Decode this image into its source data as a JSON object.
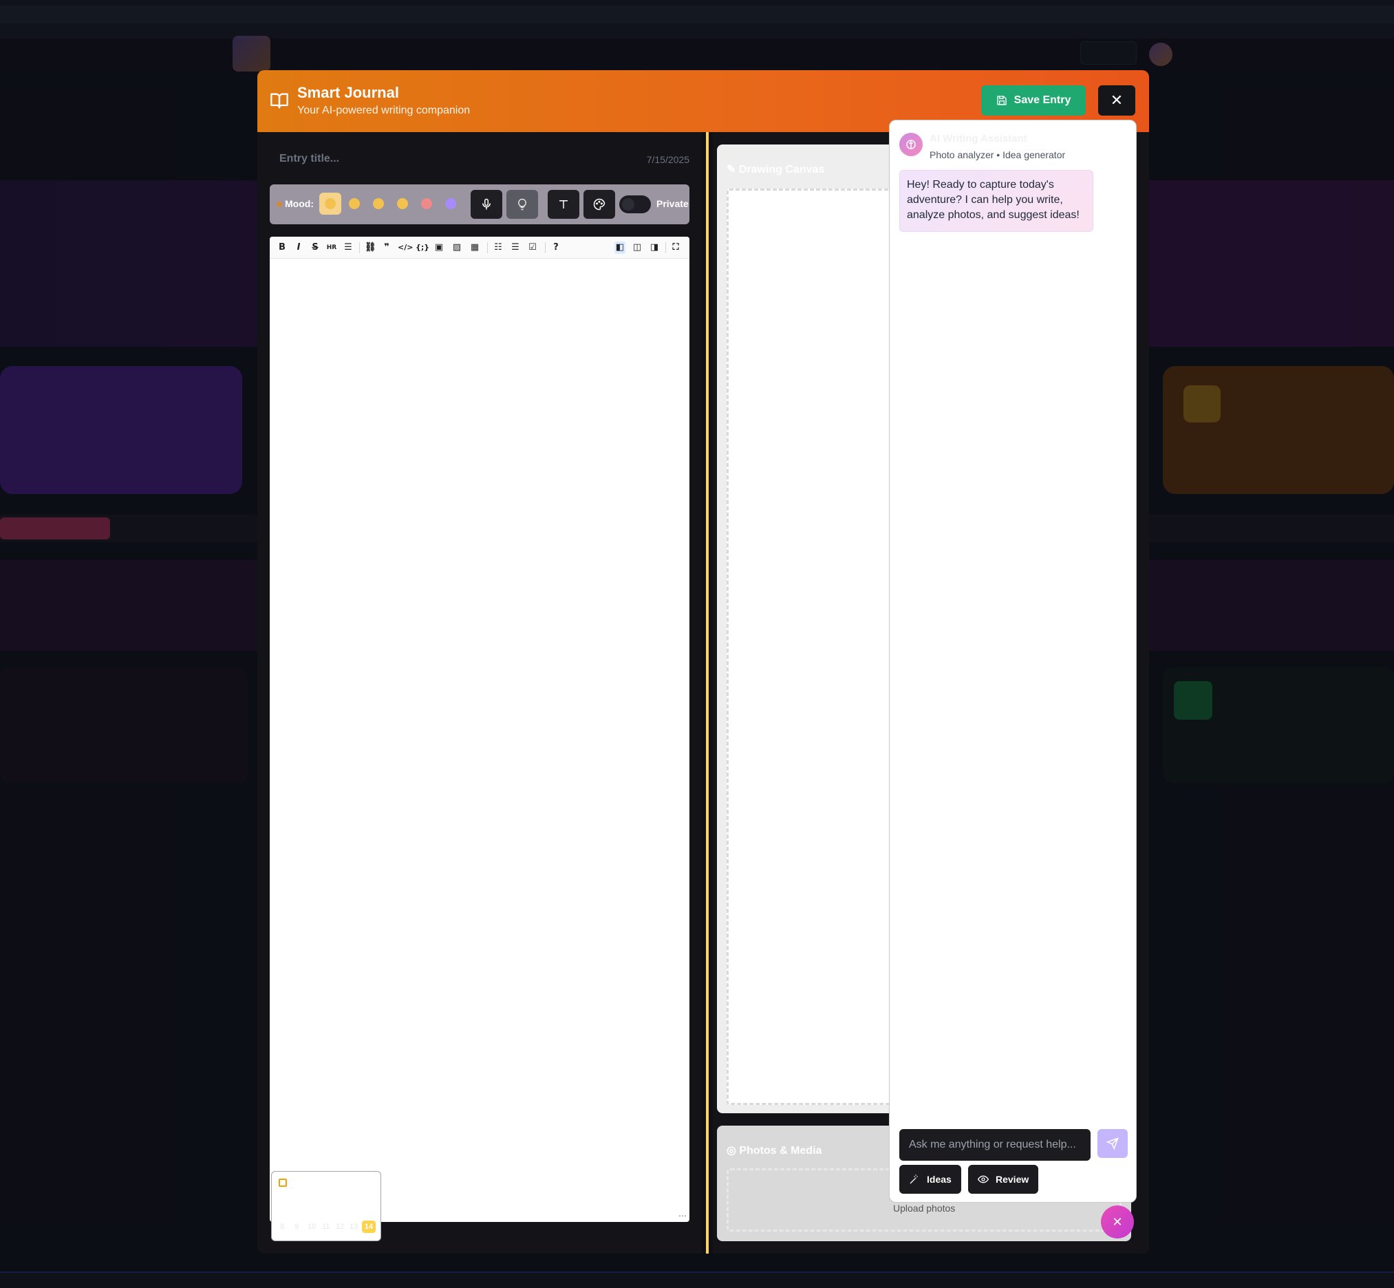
{
  "header": {
    "title": "Smart Journal",
    "subtitle": "Your AI-powered writing companion",
    "save_label": "Save Entry"
  },
  "entry": {
    "title_placeholder": "Entry title...",
    "date": "7/15/2025"
  },
  "mood": {
    "label": "Mood:",
    "private_label": "Private"
  },
  "canvas": {
    "title": "Drawing Canvas"
  },
  "photos": {
    "title": "Photos & Media",
    "upload_label": "Upload photos"
  },
  "assistant": {
    "name": "AI Writing Assistant",
    "subtitle": "Photo analyzer • Idea generator",
    "message": "Hey! Ready to capture today's adventure? I can help you write, analyze photos, and suggest ideas!",
    "input_placeholder": "Ask me anything or request help...",
    "ideas_label": "Ideas",
    "review_label": "Review"
  },
  "calendar": {
    "days": [
      "8",
      "9",
      "10",
      "11",
      "12",
      "13"
    ],
    "today": "14"
  },
  "colors": {
    "header_orange": "#e8661a",
    "save_green": "#1fa971",
    "divider_yellow": "#f8d46a",
    "assistant_accent": "#c4b5fd"
  }
}
